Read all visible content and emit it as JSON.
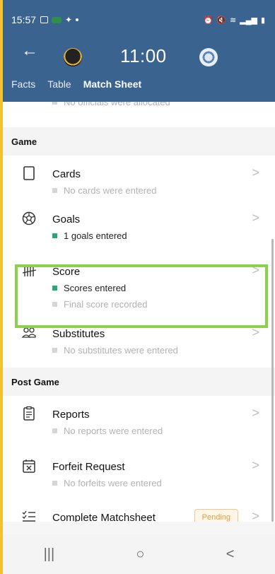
{
  "status_bar": {
    "time": "15:57"
  },
  "header": {
    "back_icon": "arrow-left-icon",
    "clock": "11:00",
    "tabs": [
      {
        "label": "Facts",
        "active": false
      },
      {
        "label": "Table",
        "active": false
      },
      {
        "label": "Match Sheet",
        "active": true
      }
    ]
  },
  "partial_item_text": "No officials were allocated",
  "sections": {
    "game": {
      "title": "Game",
      "items": [
        {
          "title": "Cards",
          "icon": "card-icon",
          "subs": [
            {
              "text": "No cards were entered",
              "done": false
            }
          ]
        },
        {
          "title": "Goals",
          "icon": "soccer-ball-icon",
          "subs": [
            {
              "text": "1 goals entered",
              "done": true
            }
          ]
        },
        {
          "title": "Score",
          "icon": "tally-marks-icon",
          "subs": [
            {
              "text": "Scores entered",
              "done": true
            },
            {
              "text": "Final score recorded",
              "done": false
            }
          ]
        },
        {
          "title": "Substitutes",
          "icon": "people-icon",
          "subs": [
            {
              "text": "No substitutes were entered",
              "done": false
            }
          ]
        }
      ]
    },
    "post_game": {
      "title": "Post Game",
      "items": [
        {
          "title": "Reports",
          "icon": "clipboard-icon",
          "subs": [
            {
              "text": "No reports were entered",
              "done": false
            }
          ]
        },
        {
          "title": "Forfeit Request",
          "icon": "calendar-x-icon",
          "subs": [
            {
              "text": "No forfeits were entered",
              "done": false
            }
          ]
        },
        {
          "title": "Complete Matchsheet",
          "icon": "checklist-icon",
          "badge": "Pending"
        }
      ]
    }
  },
  "nav": {
    "recents": "|||",
    "home": "○",
    "back": "<"
  },
  "colors": {
    "header": "#3a638f",
    "highlight": "#8bd14a",
    "done_bullet": "#2da57a",
    "pending": "#e0a040"
  }
}
